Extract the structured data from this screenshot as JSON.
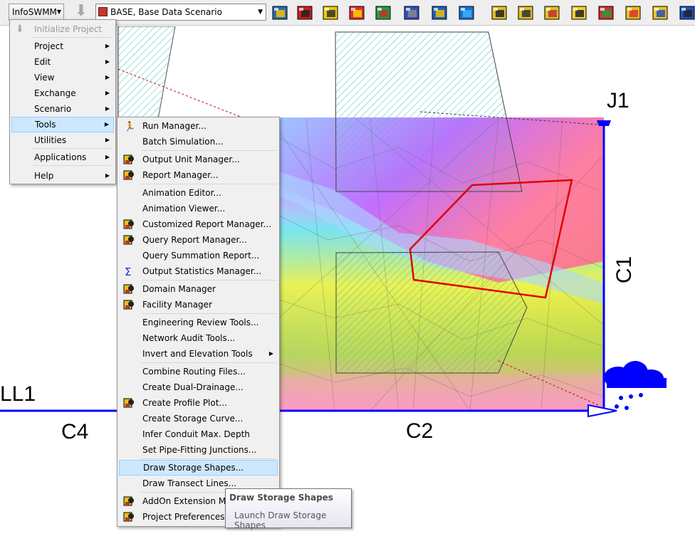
{
  "toolbar": {
    "app_label": "InfoSWMM",
    "scenario": "BASE, Base Data Scenario",
    "icons": [
      "zoom-icon",
      "tools-icon",
      "report-icon",
      "edit-icon",
      "chart-icon",
      "profile-icon",
      "query-icon",
      "globe-icon",
      "manager-icon",
      "domain-icon",
      "facility-icon",
      "statistics-icon",
      "audit-icon",
      "color-icon",
      "scenario-icon",
      "graph-icon",
      "export-icon"
    ]
  },
  "main_menu": {
    "items": [
      {
        "label": "Initialize Project",
        "state": "disabled",
        "submenu": false
      },
      {
        "label": "Project",
        "submenu": true
      },
      {
        "label": "Edit",
        "submenu": true
      },
      {
        "label": "View",
        "submenu": true
      },
      {
        "label": "Exchange",
        "submenu": true
      },
      {
        "label": "Scenario",
        "submenu": true
      },
      {
        "label": "Tools",
        "submenu": true,
        "state": "active"
      },
      {
        "label": "Utilities",
        "submenu": true
      },
      {
        "label": "Applications",
        "submenu": true
      },
      {
        "label": "Help",
        "submenu": true
      }
    ]
  },
  "tools_menu": {
    "items": [
      {
        "label": "Run Manager...",
        "icon": "run-manager-icon"
      },
      {
        "label": "Batch Simulation..."
      },
      {
        "label": "Output Unit Manager...",
        "icon": "output-unit-icon"
      },
      {
        "label": "Report Manager...",
        "icon": "report-manager-icon"
      },
      {
        "label": "Animation Editor..."
      },
      {
        "label": "Animation Viewer..."
      },
      {
        "label": "Customized Report Manager...",
        "icon": "customized-report-icon"
      },
      {
        "label": "Query Report Manager...",
        "icon": "query-report-icon"
      },
      {
        "label": "Query Summation Report..."
      },
      {
        "label": "Output Statistics Manager...",
        "icon": "sigma-icon"
      },
      {
        "label": "Domain Manager",
        "icon": "domain-manager-icon"
      },
      {
        "label": "Facility Manager",
        "icon": "facility-manager-icon"
      },
      {
        "label": "Engineering Review Tools..."
      },
      {
        "label": "Network Audit Tools..."
      },
      {
        "label": "Invert and Elevation Tools",
        "submenu": true
      },
      {
        "label": "Combine Routing Files..."
      },
      {
        "label": "Create Dual-Drainage..."
      },
      {
        "label": "Create Profile Plot...",
        "icon": "profile-plot-icon"
      },
      {
        "label": "Create Storage Curve..."
      },
      {
        "label": "Infer Conduit Max. Depth"
      },
      {
        "label": "Set Pipe-Fitting Junctions..."
      },
      {
        "label": "Draw Storage Shapes...",
        "state": "active"
      },
      {
        "label": "Draw Transect Lines..."
      },
      {
        "label": "AddOn Extension Man",
        "icon": "addon-icon"
      },
      {
        "label": "Project Preferences...",
        "icon": "preferences-icon"
      }
    ]
  },
  "tooltip": {
    "title": "Draw Storage Shapes",
    "description": "Launch Draw Storage Shapes"
  },
  "map": {
    "labels": {
      "j1": "J1",
      "c1": "C1",
      "c2": "C2",
      "c4": "C4",
      "ll1": "LL1"
    }
  },
  "colors": {
    "menu_bg": "#f0f0f0",
    "highlight": "#cce8ff",
    "conduit": "#0000ff",
    "storage_outline": "#e00000",
    "hatch": "#3fbfbf"
  }
}
